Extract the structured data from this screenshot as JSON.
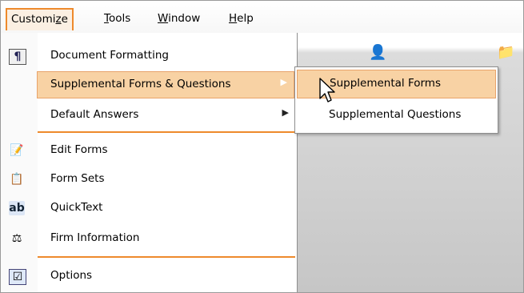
{
  "menubar": [
    {
      "label": "Customize",
      "u": "z"
    },
    {
      "label": "Tools",
      "u": "T"
    },
    {
      "label": "Window",
      "u": "W"
    },
    {
      "label": "Help",
      "u": "H"
    }
  ],
  "menu": {
    "document_formatting": "Document Formatting",
    "supplemental_forms_questions": "Supplemental Forms & Questions",
    "default_answers": "Default Answers",
    "edit_forms": "Edit Forms",
    "form_sets": "Form Sets",
    "quicktext": "QuickText",
    "firm_information": "Firm Information",
    "options": "Options"
  },
  "submenu": {
    "supplemental_forms": "Supplemental Forms",
    "supplemental_questions": "Supplemental Questions"
  },
  "icons": {
    "document_formatting": "document-formatting-icon",
    "edit_forms": "edit-forms-icon",
    "form_sets": "form-sets-icon",
    "quicktext": "quicktext-icon",
    "firm_information": "firm-information-icon",
    "options": "options-icon",
    "quicktext_glyph": "ab"
  },
  "colors": {
    "accent": "#ee8a2c",
    "highlight": "#f8d2a4",
    "highlight_border": "#e8a36a"
  }
}
